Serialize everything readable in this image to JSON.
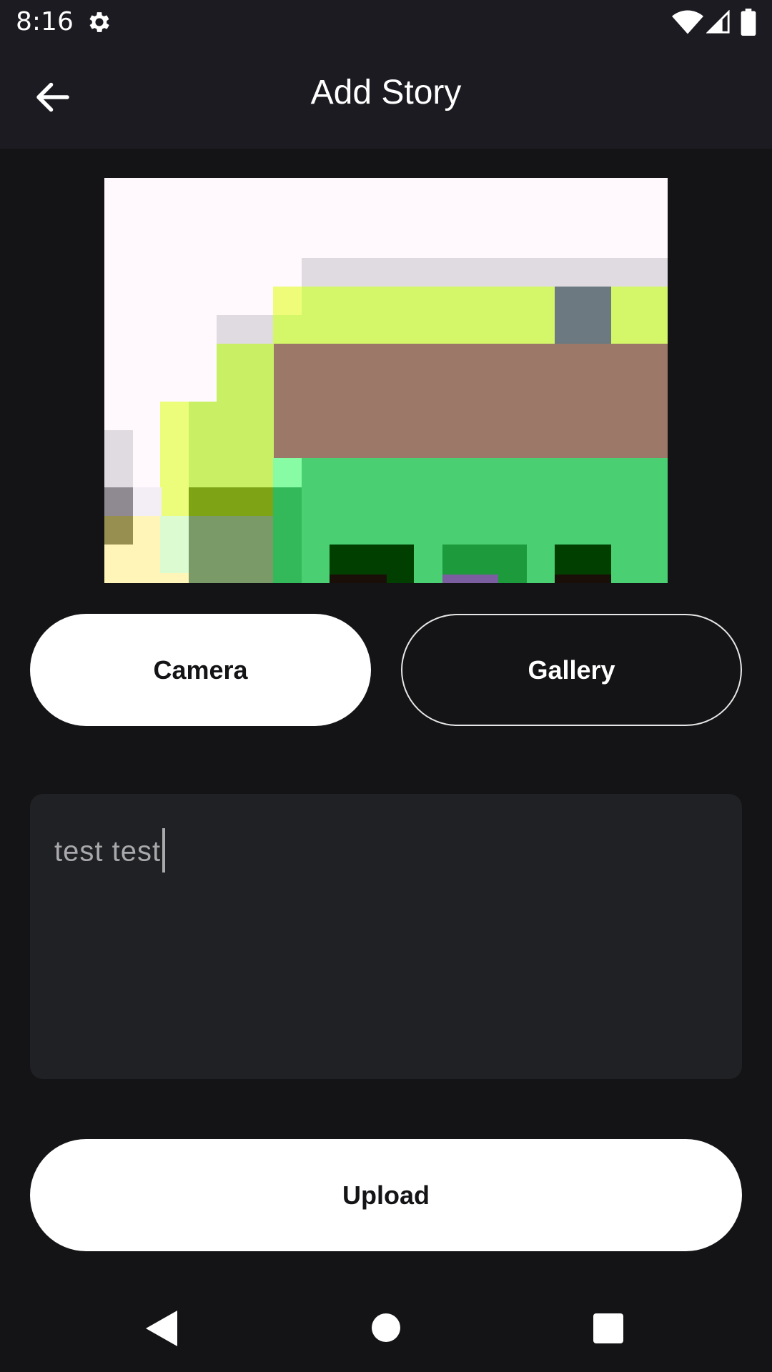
{
  "status_bar": {
    "time": "8:16",
    "icons": [
      "gear-icon",
      "wifi-icon",
      "signal-icon",
      "battery-icon"
    ]
  },
  "app_bar": {
    "title": "Add Story",
    "back_icon": "arrow-back-icon"
  },
  "preview_image": {
    "description_icon": "image-preview"
  },
  "buttons": {
    "camera_label": "Camera",
    "gallery_label": "Gallery",
    "upload_label": "Upload"
  },
  "description_input": {
    "value": "test test"
  },
  "nav_bar": {
    "icons": [
      "nav-back-icon",
      "nav-home-icon",
      "nav-recents-icon"
    ]
  },
  "colors": {
    "background": "#141416",
    "app_bar": "#1b1b21",
    "input_background": "#202125",
    "button_fill": "#ffffff",
    "button_text": "#141416"
  }
}
